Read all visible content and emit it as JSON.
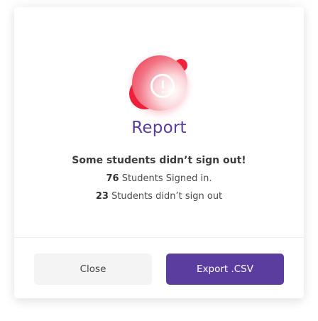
{
  "dialog": {
    "icon": "alert-circle-icon",
    "title": "Report",
    "heading": "Some students didn’t sign out!",
    "stats": [
      {
        "count": "76",
        "label": "Students Signed in."
      },
      {
        "count": "23",
        "label": "Students didn’t sign out"
      }
    ],
    "buttons": {
      "close_label": "Close",
      "export_label": "Export .CSV"
    }
  },
  "colors": {
    "accent": "#5a3d9e",
    "alert": "#ec2f46",
    "secondary_button": "#f4f4f4"
  }
}
